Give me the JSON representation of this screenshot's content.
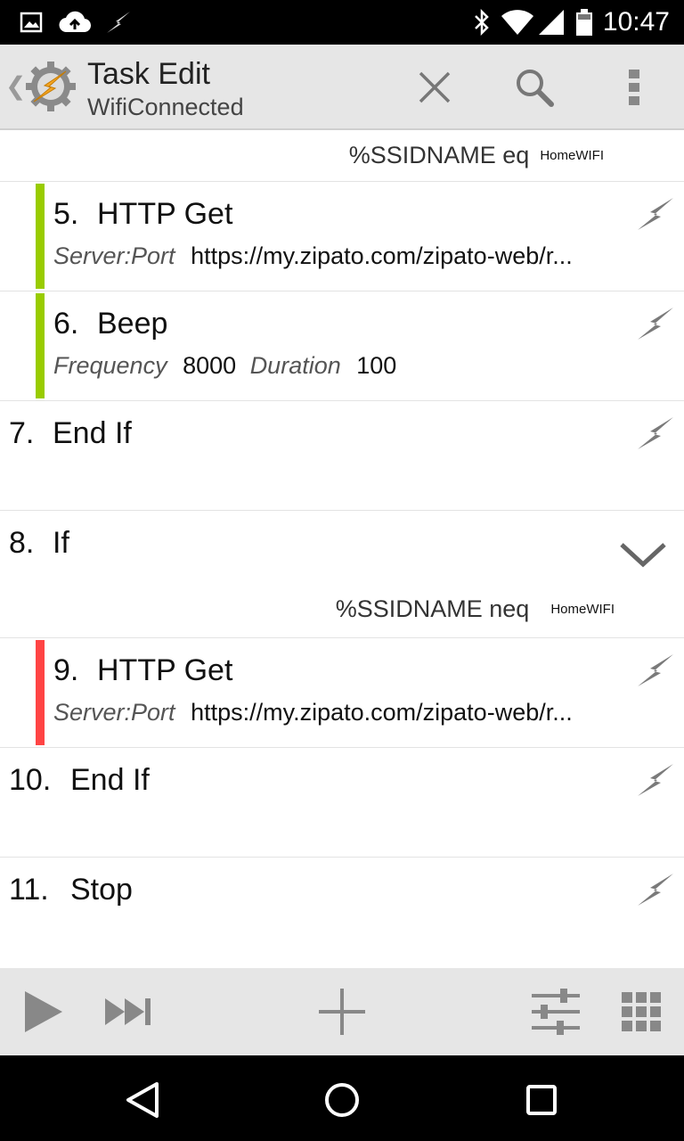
{
  "status_bar": {
    "time": "10:47",
    "left_icons": [
      "image-icon",
      "cloud-upload-icon",
      "tasker-bolt-icon"
    ],
    "right_icons": [
      "bluetooth-icon",
      "wifi-icon",
      "cell-signal-icon",
      "battery-icon"
    ]
  },
  "action_bar": {
    "title": "Task Edit",
    "subtitle": "WifiConnected",
    "actions": [
      "close-icon",
      "search-icon",
      "overflow-menu-icon"
    ]
  },
  "actions": [
    {
      "type": "condition",
      "expr": "%SSIDNAME eq",
      "value": "HomeWIFI",
      "color": "#99cc00"
    },
    {
      "number": "5.",
      "name": "HTTP Get",
      "indent_color": "#99cc00",
      "args": [
        {
          "key": "Server:Port",
          "value": "https://my.zipato.com/zipato-web/r..."
        }
      ]
    },
    {
      "number": "6.",
      "name": "Beep",
      "indent_color": "#99cc00",
      "args": [
        {
          "key": "Frequency",
          "value": "8000"
        },
        {
          "key": "Duration",
          "value": "100"
        }
      ]
    },
    {
      "number": "7.",
      "name": "End If"
    },
    {
      "number": "8.",
      "name": "If",
      "expanded": true
    },
    {
      "type": "condition",
      "expr": "%SSIDNAME neq",
      "value": "HomeWIFI",
      "color": "#ff4444"
    },
    {
      "number": "9.",
      "name": "HTTP Get",
      "indent_color": "#ff4444",
      "args": [
        {
          "key": "Server:Port",
          "value": "https://my.zipato.com/zipato-web/r..."
        }
      ]
    },
    {
      "number": "10.",
      "name": "End If"
    },
    {
      "number": "11.",
      "name": "Stop"
    }
  ],
  "bottom_toolbar": [
    "play-icon",
    "skip-forward-icon",
    "add-icon",
    "sliders-icon",
    "grid-icon"
  ],
  "nav_bar": [
    "back-triangle-icon",
    "home-circle-icon",
    "recents-square-icon"
  ],
  "colors": {
    "if_true": "#99cc00",
    "if_false": "#ff4444",
    "toolbar_bg": "#e6e6e6",
    "icon_gray": "#888888"
  }
}
